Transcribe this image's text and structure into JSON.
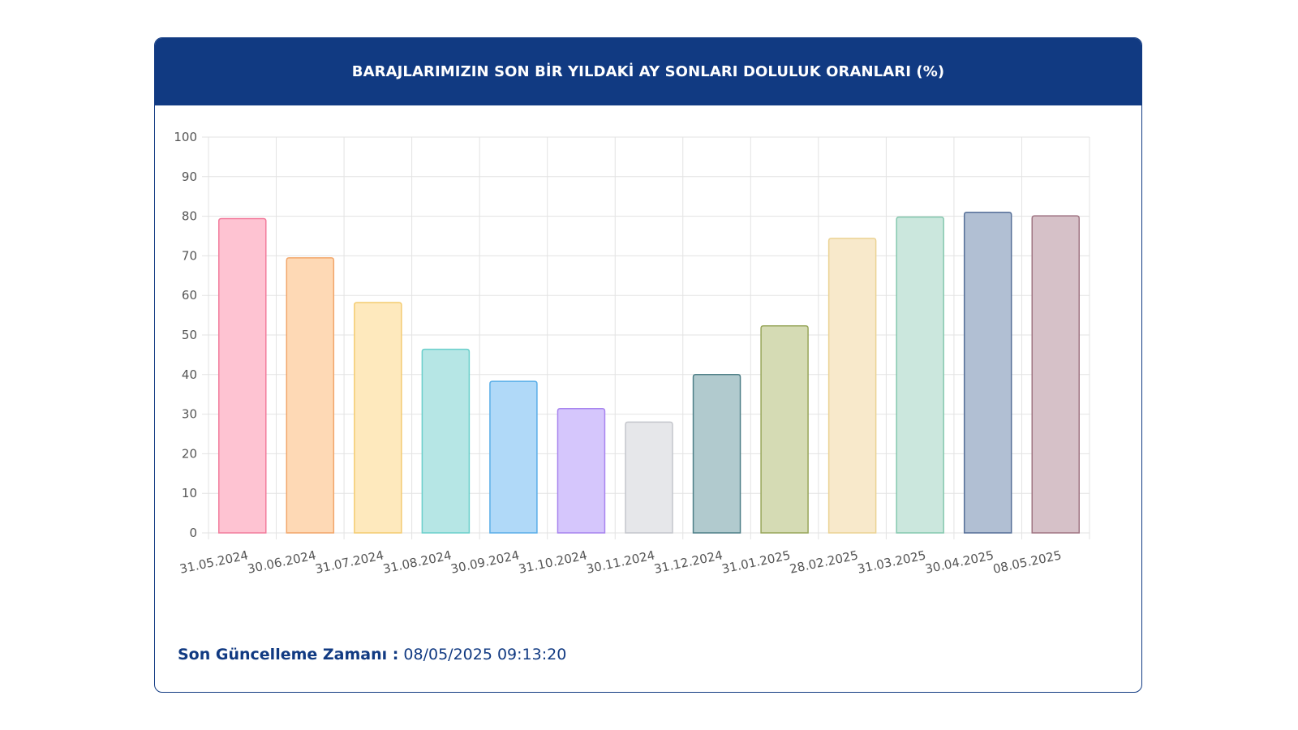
{
  "header": {
    "title": "BARAJLARIMIZIN SON BİR YILDAKİ AY SONLARI DOLULUK ORANLARI (%)"
  },
  "footer": {
    "label": "Son Güncelleme Zamanı :",
    "value": "08/05/2025 09:13:20"
  },
  "colors": {
    "header_bg": "#113a82",
    "gridline": "#e3e3e3"
  },
  "chart_data": {
    "type": "bar",
    "title": "BARAJLARIMIZIN SON BİR YILDAKİ AY SONLARI DOLULUK ORANLARI (%)",
    "xlabel": "",
    "ylabel": "",
    "ylim": [
      0,
      100
    ],
    "yticks": [
      0,
      10,
      20,
      30,
      40,
      50,
      60,
      70,
      80,
      90,
      100
    ],
    "grid": true,
    "legend": "none",
    "categories": [
      "31.05.2024",
      "30.06.2024",
      "31.07.2024",
      "31.08.2024",
      "30.09.2024",
      "31.10.2024",
      "30.11.2024",
      "31.12.2024",
      "31.01.2025",
      "28.02.2025",
      "31.03.2025",
      "30.04.2025",
      "08.05.2025"
    ],
    "values": [
      79.4,
      69.5,
      58.2,
      46.4,
      38.3,
      31.4,
      28.0,
      40.0,
      52.3,
      74.4,
      79.8,
      81.0,
      80.1
    ],
    "bar_fill_colors": [
      "#fec3d2",
      "#fed9b5",
      "#fee9bd",
      "#b6e6e5",
      "#b0d9f8",
      "#d5c6fc",
      "#e6e7ea",
      "#b1cace",
      "#d5dbb4",
      "#f8e9cb",
      "#cbe7dd",
      "#b1bfd3",
      "#d6c1c8"
    ],
    "bar_border_colors": [
      "#f27c9c",
      "#f2a66a",
      "#f4cc70",
      "#6acfcb",
      "#5aaee8",
      "#a784ee",
      "#c4c6cc",
      "#4e7f87",
      "#98a65a",
      "#ebd394",
      "#84c8ae",
      "#566f98",
      "#a07583"
    ]
  }
}
